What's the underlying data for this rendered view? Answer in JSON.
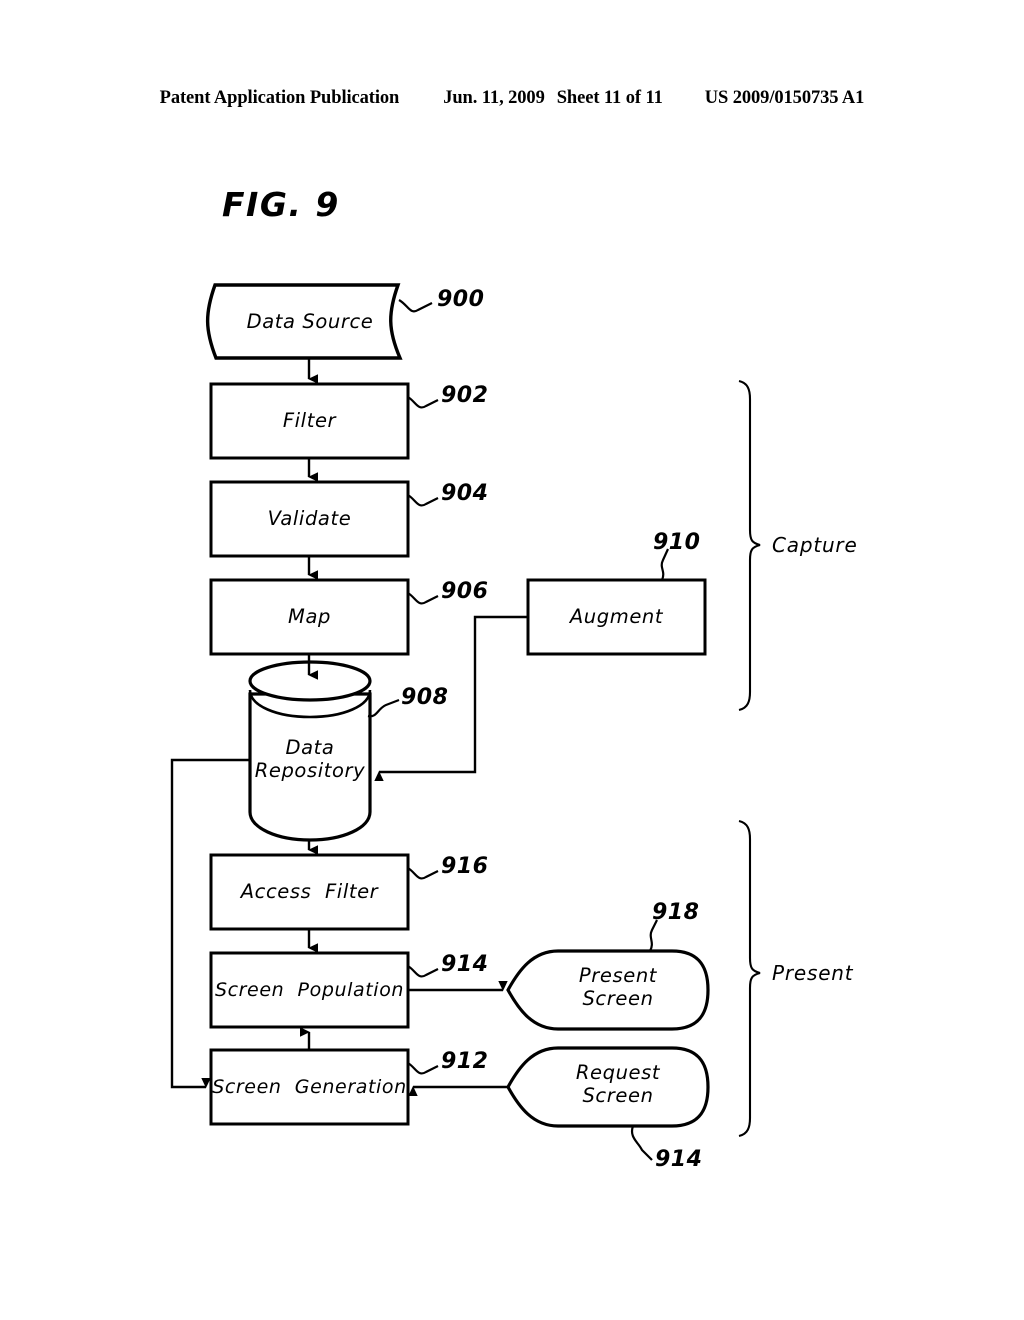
{
  "header": {
    "publication": "Patent Application Publication",
    "date": "Jun. 11, 2009",
    "sheet": "Sheet 11 of 11",
    "patent_number": "US 2009/0150735 A1"
  },
  "figure": {
    "title": "FIG. 9",
    "ink_color": "#000000",
    "paper_color": "#ffffff"
  },
  "nodes": {
    "data_source": {
      "label": "Data Source",
      "ref": "900",
      "shape": "tape"
    },
    "filter": {
      "label": "Filter",
      "ref": "902",
      "shape": "rect"
    },
    "validate": {
      "label": "Validate",
      "ref": "904",
      "shape": "rect"
    },
    "map": {
      "label": "Map",
      "ref": "906",
      "shape": "rect"
    },
    "data_repository": {
      "label_line1": "Data",
      "label_line2": "Repository",
      "ref": "908",
      "shape": "cylinder"
    },
    "augment": {
      "label": "Augment",
      "ref": "910",
      "shape": "rect"
    },
    "access_filter": {
      "label": "Access  Filter",
      "ref": "916",
      "shape": "rect"
    },
    "screen_population": {
      "label": "Screen  Population",
      "ref": "914",
      "shape": "rect"
    },
    "screen_generation": {
      "label": "Screen  Generation",
      "ref": "912",
      "shape": "rect"
    },
    "present_screen": {
      "label_line1": "Present",
      "label_line2": "Screen",
      "ref": "918",
      "shape": "display"
    },
    "request_screen": {
      "label_line1": "Request",
      "label_line2": "Screen",
      "ref": "914",
      "shape": "display"
    }
  },
  "groups": {
    "capture": {
      "label": "Capture"
    },
    "present": {
      "label": "Present"
    }
  }
}
